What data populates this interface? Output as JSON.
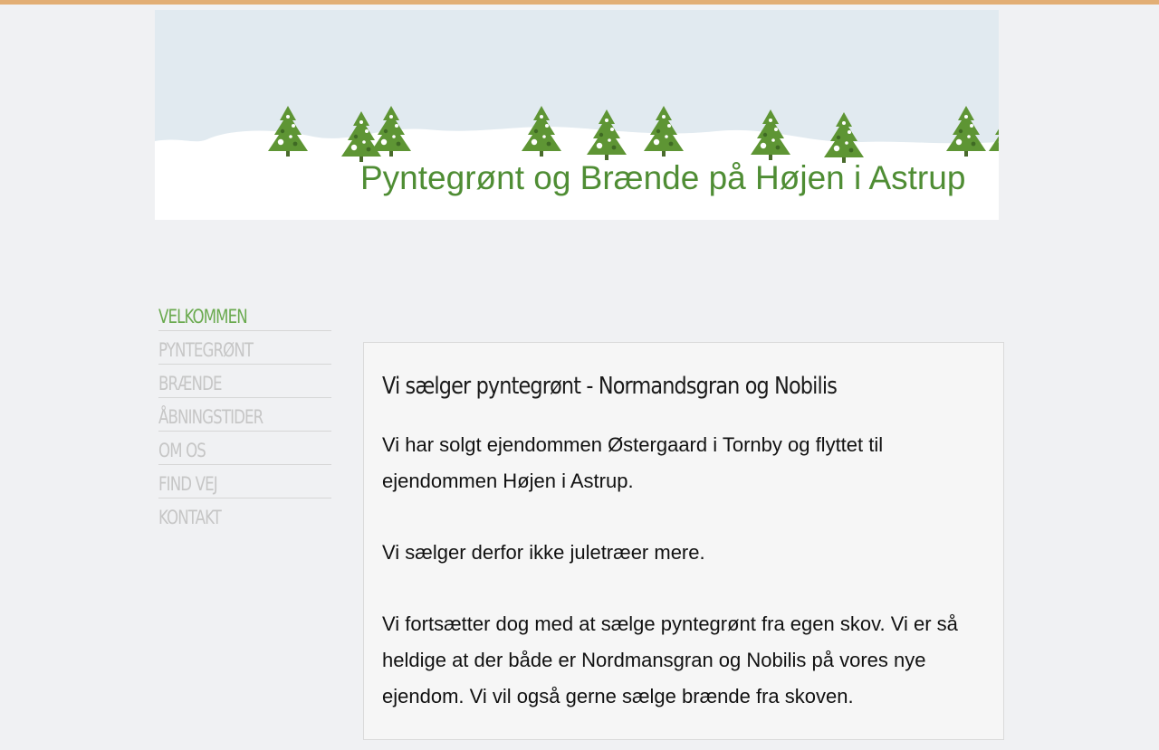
{
  "colors": {
    "top_stripe": "#e2ae74",
    "title_green": "#4f8d34",
    "tree_green": "#5e9534",
    "nav_active": "#6aaa4f",
    "nav_inactive": "#c6c6c6",
    "sky": "#e1eaf0"
  },
  "header": {
    "site_title": "Pyntegrønt og Brænde på Højen i Astrup",
    "banner_icon": "christmas-trees-snow-scene"
  },
  "nav": {
    "items": [
      {
        "label": "VELKOMMEN",
        "active": true
      },
      {
        "label": "PYNTEGRØNT",
        "active": false
      },
      {
        "label": "BRÆNDE",
        "active": false
      },
      {
        "label": "ÅBNINGSTIDER",
        "active": false
      },
      {
        "label": "OM OS",
        "active": false
      },
      {
        "label": "FIND VEJ",
        "active": false
      },
      {
        "label": "KONTAKT",
        "active": false
      }
    ]
  },
  "main": {
    "heading": "Vi sælger pyntegrønt - Normandsgran og Nobilis",
    "paragraphs": [
      "Vi har solgt ejendommen Østergaard i Tornby og flyttet til ejendommen Højen i Astrup.",
      "Vi sælger derfor ikke juletræer mere.",
      "Vi fortsætter dog med at sælge pyntegrønt fra egen skov. Vi er så heldige at der både er Nordmansgran og Nobilis på vores nye ejendom. Vi vil også gerne sælge brænde fra skoven."
    ]
  }
}
